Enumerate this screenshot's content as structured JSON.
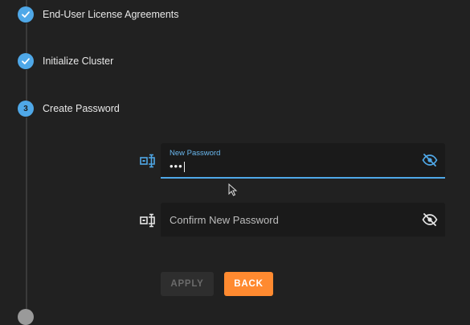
{
  "steps": [
    {
      "label": "End-User License Agreements",
      "state": "complete"
    },
    {
      "label": "Initialize Cluster",
      "state": "complete"
    },
    {
      "label": "Create Password",
      "state": "active",
      "number": "3"
    }
  ],
  "password_form": {
    "new_password": {
      "label": "New Password",
      "value": "•••",
      "icon": "password-field-icon",
      "toggle_icon": "visibility-off-icon"
    },
    "confirm_password": {
      "placeholder": "Confirm New Password",
      "icon": "password-field-icon",
      "toggle_icon": "visibility-off-icon"
    }
  },
  "buttons": {
    "apply": "APPLY",
    "back": "BACK"
  },
  "colors": {
    "accent": "#4fa8e8",
    "back_button": "#ff8a30",
    "background": "#212121"
  }
}
